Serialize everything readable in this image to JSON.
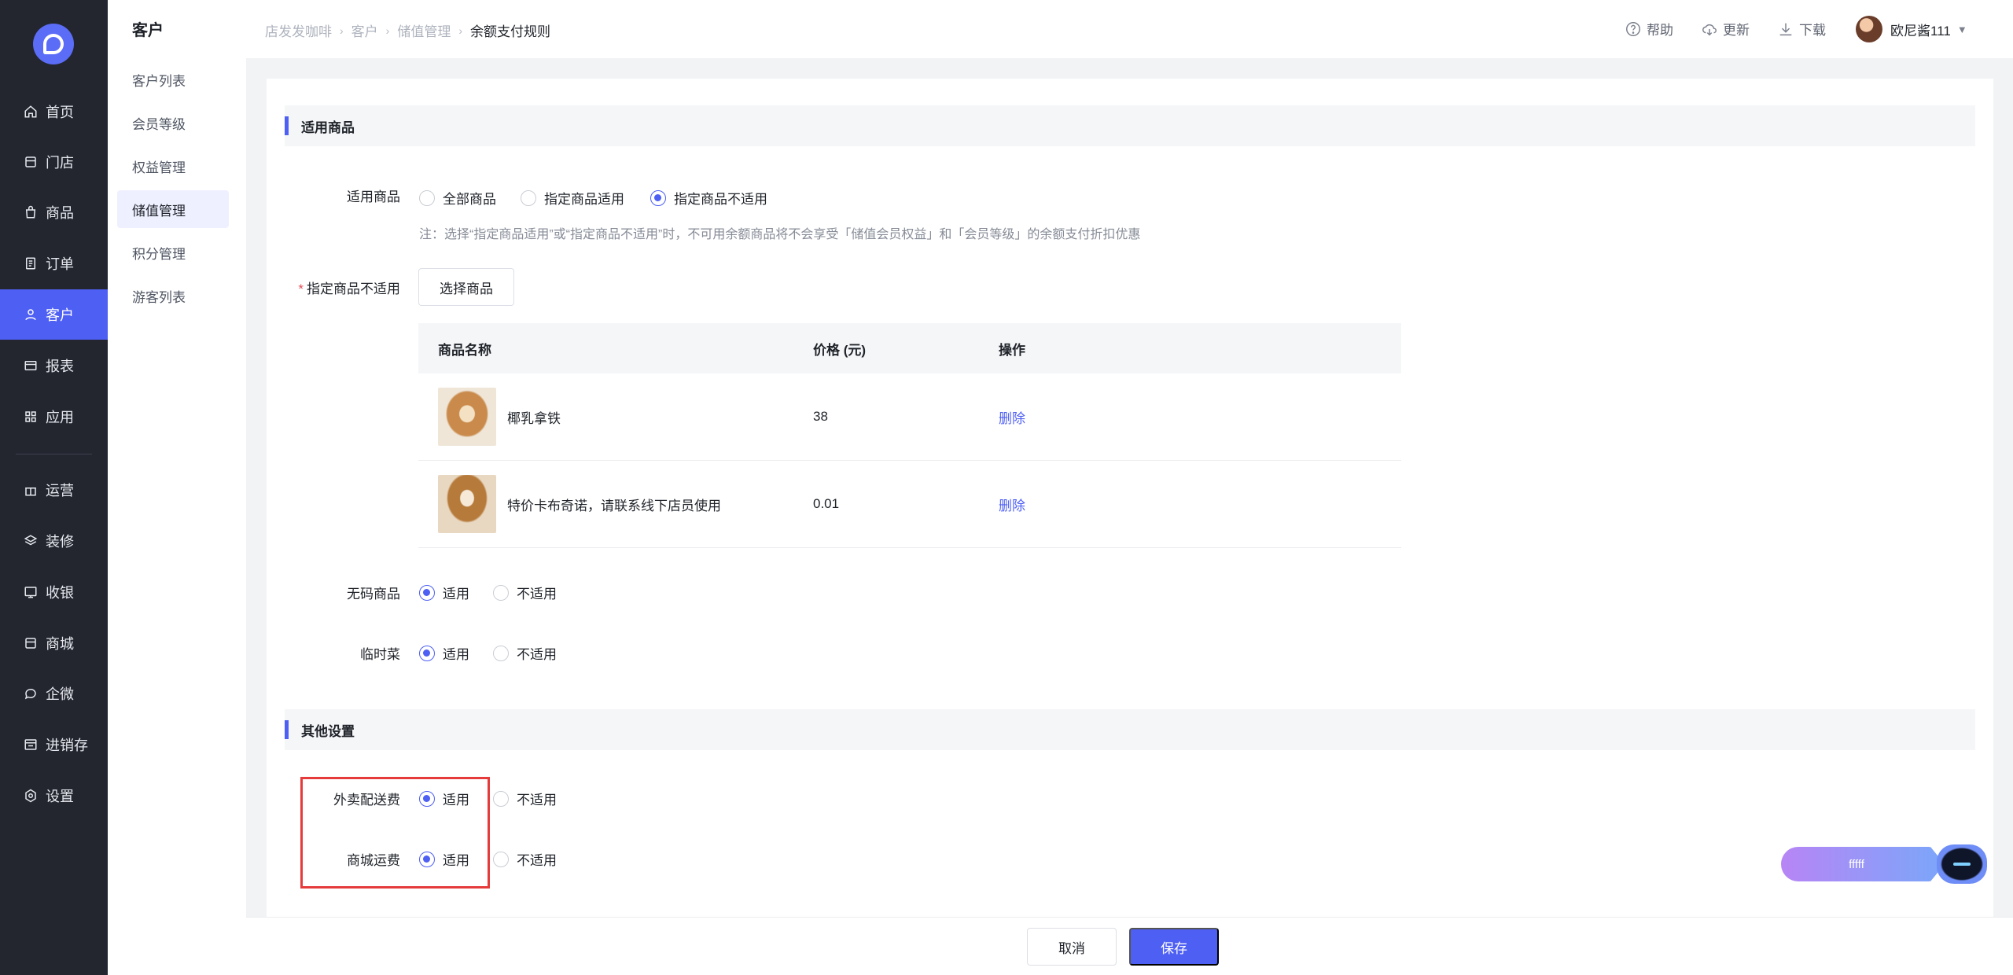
{
  "nav": {
    "items": [
      {
        "label": "首页",
        "icon": "home-icon"
      },
      {
        "label": "门店",
        "icon": "store-icon"
      },
      {
        "label": "商品",
        "icon": "bag-icon"
      },
      {
        "label": "订单",
        "icon": "order-icon"
      },
      {
        "label": "客户",
        "icon": "user-icon"
      },
      {
        "label": "报表",
        "icon": "report-icon"
      },
      {
        "label": "应用",
        "icon": "apps-icon"
      },
      {
        "label": "运营",
        "icon": "gift-icon"
      },
      {
        "label": "装修",
        "icon": "layers-icon"
      },
      {
        "label": "收银",
        "icon": "cashier-icon"
      },
      {
        "label": "商城",
        "icon": "mall-icon"
      },
      {
        "label": "企微",
        "icon": "chat-icon"
      },
      {
        "label": "进销存",
        "icon": "inventory-icon"
      },
      {
        "label": "设置",
        "icon": "settings-icon"
      }
    ],
    "active": "客户"
  },
  "sub": {
    "title": "客户",
    "items": [
      "客户列表",
      "会员等级",
      "权益管理",
      "储值管理",
      "积分管理",
      "游客列表"
    ],
    "active": "储值管理"
  },
  "header": {
    "breadcrumbs": [
      "店发发咖啡",
      "客户",
      "储值管理",
      "余额支付规则"
    ],
    "help": "帮助",
    "update": "更新",
    "download": "下载",
    "user": "欧尼酱111"
  },
  "section1": {
    "title": "适用商品",
    "goods_label": "适用商品",
    "goods_options": [
      "全部商品",
      "指定商品适用",
      "指定商品不适用"
    ],
    "goods_selected": "指定商品不适用",
    "note": "注：选择“指定商品适用”或“指定商品不适用”时，不可用余额商品将不会享受「储值会员权益」和「会员等级」的余额支付折扣优惠",
    "excluded_label": "指定商品不适用",
    "select_button": "选择商品",
    "table": {
      "headers": [
        "商品名称",
        "价格 (元)",
        "操作"
      ],
      "rows": [
        {
          "name": "椰乳拿铁",
          "price": "38",
          "action": "删除"
        },
        {
          "name": "特价卡布奇诺，请联系线下店员使用",
          "price": "0.01",
          "action": "删除"
        }
      ]
    },
    "nocode_label": "无码商品",
    "temp_label": "临时菜",
    "options": [
      "适用",
      "不适用"
    ]
  },
  "section2": {
    "title": "其他设置",
    "delivery_label": "外卖配送费",
    "mall_label": "商城运费",
    "options": [
      "适用",
      "不适用"
    ]
  },
  "footer": {
    "cancel": "取消",
    "save": "保存"
  },
  "float_widget": {
    "label": "fffff"
  },
  "colors": {
    "accent": "#4e5ff3",
    "nav_bg": "#23262f",
    "highlight": "#e63b3b"
  }
}
